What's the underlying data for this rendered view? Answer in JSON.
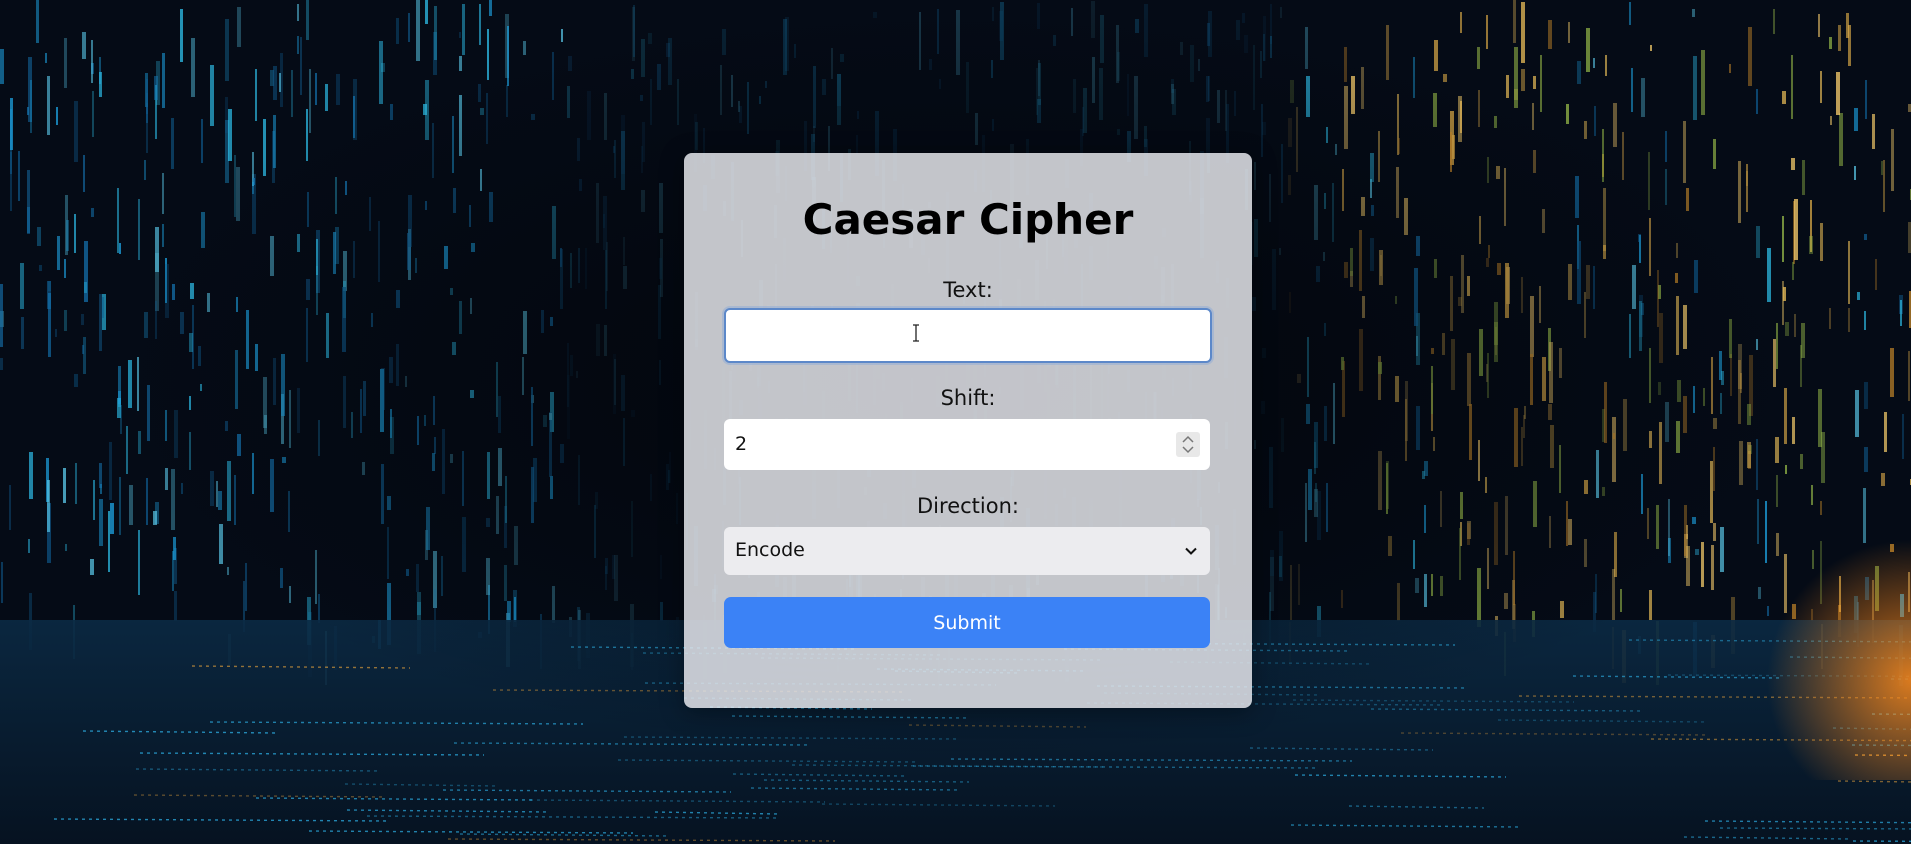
{
  "app": {
    "title": "Caesar Cipher"
  },
  "form": {
    "text": {
      "label": "Text:",
      "value": "",
      "placeholder": ""
    },
    "shift": {
      "label": "Shift:",
      "value": "2"
    },
    "direction": {
      "label": "Direction:",
      "selected": "Encode"
    },
    "submit_label": "Submit"
  },
  "icons": {
    "text_cursor": "text-cursor-icon",
    "stepper": "spinner-arrows-icon",
    "dropdown": "chevron-down-icon"
  },
  "colors": {
    "accent": "#3b82f6",
    "focus_border": "#5c88c9",
    "card_bg": "#e8eaee"
  }
}
